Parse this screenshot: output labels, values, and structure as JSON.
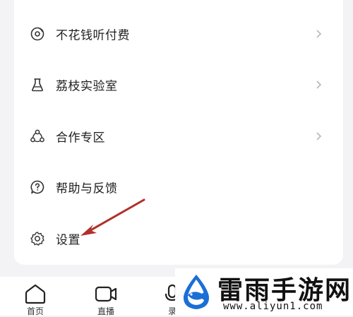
{
  "menu": {
    "items": [
      {
        "label": "不花钱听付费",
        "icon": "music-disc-icon",
        "has_chevron": true
      },
      {
        "label": "荔枝实验室",
        "icon": "flask-icon",
        "has_chevron": true
      },
      {
        "label": "合作专区",
        "icon": "cooperation-icon",
        "has_chevron": true
      },
      {
        "label": "帮助与反馈",
        "icon": "help-chat-icon",
        "has_chevron": false
      },
      {
        "label": "设置",
        "icon": "gear-icon",
        "has_chevron": false
      }
    ]
  },
  "bottom_nav": {
    "items": [
      {
        "label": "首页",
        "icon": "home-icon"
      },
      {
        "label": "直播",
        "icon": "video-camera-icon"
      },
      {
        "label": "录",
        "icon": "microphone-icon"
      }
    ]
  },
  "watermark": {
    "title": "雷雨手游网",
    "url": "www.aliyun1.com"
  },
  "colors": {
    "annotation_arrow": "#b0302a",
    "text_primary": "#1f1f1f",
    "icon_stroke": "#333333",
    "chevron": "#b8b8b8",
    "watermark_blue": "#1a6fd6"
  }
}
